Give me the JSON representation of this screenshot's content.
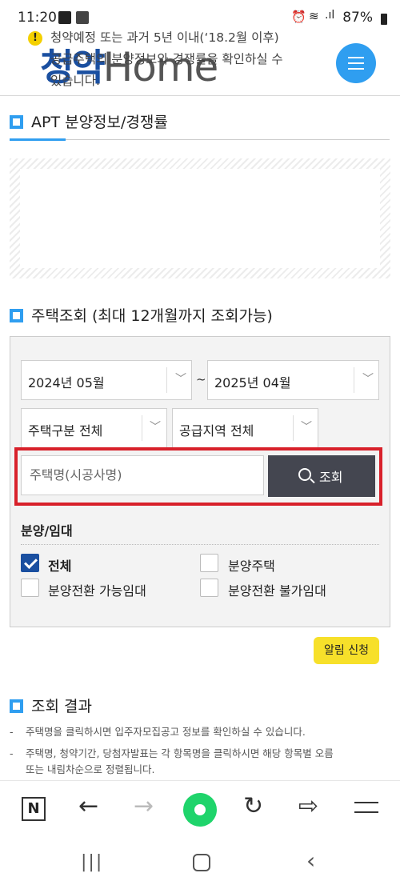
{
  "status_bar": {
    "time": "11:20",
    "battery": "87%"
  },
  "header": {
    "logo_kr": "청약",
    "logo_en": "Home",
    "menu_icon": "hamburger-icon"
  },
  "page": {
    "section_title": "APT 분양정보/경쟁률"
  },
  "notice": {
    "line1": "청약예정 또는 과거 5년 이내(‘18.2월 이후)",
    "line2": "공급주택의 분양정보와 경쟁률을 확인하실 수",
    "line3": "있습니다."
  },
  "search": {
    "title": "주택조회 (최대 12개월까지 조회가능)",
    "start_month": "2024년 05월",
    "tilde": "~",
    "end_month": "2025년 04월",
    "house_type": "주택구분 전체",
    "region": "공급지역 전체",
    "name_placeholder": "주택명(시공사명)",
    "search_button": "조회",
    "type_label": "분양/임대",
    "options": {
      "all": "전체",
      "sale_house": "분양주택",
      "conv_possible": "분양전환 가능임대",
      "conv_impossible": "분양전환 불가임대"
    },
    "all_checked": true
  },
  "alert_button": "알림 신청",
  "results": {
    "title": "조회 결과",
    "notes": [
      "주택명을 클릭하시면 입주자모집공고 정보를 확인하실 수 있습니다.",
      "주택명, 청약기간, 당첨자발표는 각 항목명을 클릭하시면 해당 항목별 오름",
      "또는 내림차순으로 정렬됩니다."
    ],
    "dash": "-"
  },
  "colors": {
    "accent": "#2f9ef0",
    "brand": "#1a4fa0",
    "highlight": "#d8202a",
    "alert": "#f7e02a"
  }
}
